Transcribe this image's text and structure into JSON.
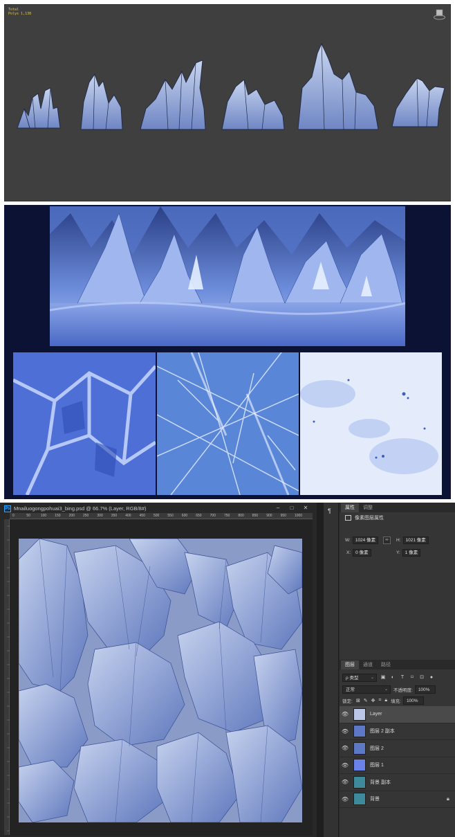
{
  "viewport": {
    "stats": [
      "Total",
      "Polys  1,138"
    ]
  },
  "photoshop": {
    "title": "Mnailuogongpohuai3_bing.psd @ 66.7% (Layer, RGB/8#)",
    "window_buttons": [
      "–",
      "□",
      "✕"
    ],
    "ruler_ticks": [
      "0",
      "50",
      "100",
      "150",
      "200",
      "250",
      "300",
      "350",
      "400",
      "450",
      "500",
      "550",
      "600",
      "650",
      "700",
      "750",
      "800",
      "850",
      "900",
      "950",
      "1000"
    ],
    "properties": {
      "tabs": [
        "属性",
        "调整"
      ],
      "header": "像素图层属性",
      "w_label": "W:",
      "w_value": "1024 像素",
      "h_label": "H:",
      "h_value": "1021 像素",
      "x_label": "X:",
      "x_value": "0 像素",
      "y_label": "Y:",
      "y_value": "1 像素",
      "link_icon": "link-icon"
    },
    "layers": {
      "tabs": [
        "图层",
        "通道",
        "路径"
      ],
      "filter_kind": "ρ 类型",
      "blend_mode": "正常",
      "opacity_label": "不透明度:",
      "opacity_value": "100%",
      "lock_label": "锁定:",
      "fill_label": "填充:",
      "fill_value": "100%",
      "items": [
        {
          "name": "Layer",
          "selected": true,
          "thumb": "#b9c6e6"
        },
        {
          "name": "图层 2 副本",
          "selected": false,
          "thumb": "#5d78c4"
        },
        {
          "name": "图层 2",
          "selected": false,
          "thumb": "#5d78c4"
        },
        {
          "name": "图层 1",
          "selected": false,
          "thumb": "#6b82e8"
        },
        {
          "name": "背景 副本",
          "selected": false,
          "thumb": "#3f8a9a"
        },
        {
          "name": "背景",
          "selected": false,
          "thumb": "#3f8a9a",
          "locked": true
        }
      ]
    }
  },
  "colors": {
    "viewport_bg": "#3f3f3f",
    "ice_light": "#c9d6f0",
    "ice_mid": "#8fa6d8",
    "ice_dark": "#4e66a8",
    "concept_bg": "#0b1234",
    "ps_bg": "#282828",
    "ps_accent": "#31a8ff"
  }
}
